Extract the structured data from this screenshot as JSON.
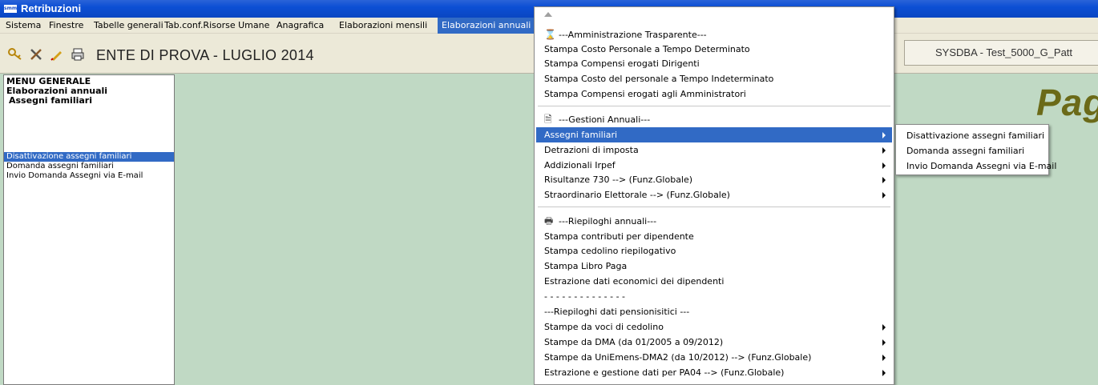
{
  "app": {
    "title": "Retribuzioni",
    "logo_text": "smm"
  },
  "menubar": {
    "items": [
      "Sistema",
      "Finestre",
      "Tabelle generali",
      "Tab.conf.Risorse Umane",
      "Anagrafica",
      "Elaborazioni mensili",
      "Elaborazioni annuali"
    ],
    "active": "Elaborazioni annuali"
  },
  "toolbar": {
    "icons": [
      "key-icon",
      "tools-icon",
      "pen-icon",
      "printer-icon"
    ],
    "title": "ENTE DI PROVA - LUGLIO 2014",
    "user_info": "SYSDBA - Test_5000_G_Patt"
  },
  "left_panel": {
    "heading1": "MENU GENERALE",
    "heading2": "Elaborazioni annuali",
    "heading3": "Assegni familiari",
    "items": [
      "Disattivazione assegni familiari",
      "Domanda assegni familiari",
      "Invio Domanda Assegni via E-mail"
    ],
    "selected": "Disattivazione assegni familiari"
  },
  "background_text": "Pagi",
  "dropdown": {
    "sections": [
      {
        "header": "---Amministrazione Trasparente---",
        "icon": "hourglass-icon",
        "items": [
          {
            "label": "Stampa Costo Personale a Tempo Determinato"
          },
          {
            "label": "Stampa Compensi erogati Dirigenti"
          },
          {
            "label": "Stampa Costo del personale a Tempo Indeterminato"
          },
          {
            "label": "Stampa Compensi erogati agli Amministratori"
          }
        ]
      },
      {
        "header": "---Gestioni Annuali---",
        "icon": "documents-icon",
        "items": [
          {
            "label": "Assegni familiari",
            "submenu": true,
            "highlighted": true
          },
          {
            "label": "Detrazioni di imposta",
            "submenu": true
          },
          {
            "label": "Addizionali Irpef",
            "submenu": true
          },
          {
            "label": "Risultanze 730 --> (Funz.Globale)",
            "submenu": true
          },
          {
            "label": "Straordinario Elettorale --> (Funz.Globale)",
            "submenu": true
          }
        ]
      },
      {
        "header": "---Riepiloghi annuali---",
        "icon": "printer-icon",
        "items": [
          {
            "label": "Stampa contributi per dipendente"
          },
          {
            "label": "Stampa cedolino riepilogativo"
          },
          {
            "label": "Stampa Libro Paga"
          },
          {
            "label": "Estrazione dati economici dei dipendenti"
          },
          {
            "label": "- - - - - - - - - - - - - -"
          },
          {
            "label": "---Riepiloghi dati pensionisitici ---"
          },
          {
            "label": "Stampe da voci di cedolino",
            "submenu": true
          },
          {
            "label": "Stampe da DMA (da 01/2005 a 09/2012)",
            "submenu": true
          },
          {
            "label": "Stampe da UniEmens-DMA2 (da 10/2012)  --> (Funz.Globale)",
            "submenu": true
          },
          {
            "label": "Estrazione e gestione dati per PA04  --> (Funz.Globale)",
            "submenu": true
          }
        ]
      }
    ]
  },
  "submenu": {
    "items": [
      "Disattivazione assegni familiari",
      "Domanda assegni familiari",
      "Invio Domanda Assegni via E-mail"
    ]
  }
}
